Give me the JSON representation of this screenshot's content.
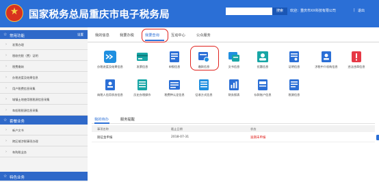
{
  "header": {
    "title": "国家税务总局重庆市电子税务局",
    "search_button": "搜索",
    "welcome": "欢迎：重庆市XX科技有限公司",
    "separator": "|",
    "logout": "退出"
  },
  "sidebar": {
    "section1": {
      "label": "常用功能",
      "setting": "设置"
    },
    "items1": [
      "发票办理",
      "税收完税（费）证明",
      "税费缴纳",
      "办税进度及结果信息",
      "用户税费信息采集",
      "城镇土地使用税税源信息采集",
      "车船税税源信息采集"
    ],
    "section2": {
      "label": "套餐业务"
    },
    "items2": [
      "新户文书",
      "跨区域涉税事项办理",
      "车购税业务"
    ],
    "section3": {
      "label": "特色业务"
    }
  },
  "tabs": [
    "我的信息",
    "我要办税",
    "我要查询",
    "互动中心",
    "公众服务"
  ],
  "active_tab": "我要查询",
  "icons": [
    {
      "label": "办税进度及结果信息",
      "icon": "progress-arrows-icon",
      "color": "#1f8fe0"
    },
    {
      "label": "发票信息",
      "icon": "invoice-icon",
      "color": "#18a6a6"
    },
    {
      "label": "申报信息",
      "icon": "declaration-icon",
      "color": "#2b6fd6"
    },
    {
      "label": "缴款信息",
      "icon": "payment-card-icon",
      "color": "#2b6fd6"
    },
    {
      "label": "文书信息",
      "icon": "document-icon",
      "color": "#1f8fe0"
    },
    {
      "label": "优惠信息",
      "icon": "discount-user-icon",
      "color": "#18a6a6"
    },
    {
      "label": "证明信息",
      "icon": "certificate-icon",
      "color": "#2b6fd6"
    },
    {
      "label": "涉税中介机构信息",
      "icon": "agency-icon",
      "color": "#2b6fd6"
    },
    {
      "label": "违法违章信息",
      "icon": "warning-icon",
      "color": "#e63946"
    },
    {
      "label": "纳税人信用状态信息",
      "icon": "credit-icon",
      "color": "#2b6fd6"
    },
    {
      "label": "历史办税操作",
      "icon": "history-icon",
      "color": "#18a6a6"
    },
    {
      "label": "税费种认定信息",
      "icon": "tax-type-icon",
      "color": "#2b6fd6"
    },
    {
      "label": "征收方式信息",
      "icon": "collection-icon",
      "color": "#1f8fe0"
    },
    {
      "label": "财务报表",
      "icon": "report-icon",
      "color": "#2b6fd6"
    },
    {
      "label": "存款账户信息",
      "icon": "account-icon",
      "color": "#2b6fd6"
    },
    {
      "label": "税源信息",
      "icon": "tax-source-icon",
      "color": "#2b6fd6"
    }
  ],
  "lower": {
    "tabs": [
      "我的待办",
      "服务提醒"
    ],
    "columns": [
      "事项名称",
      "截止日期",
      "状态",
      "操作"
    ],
    "rows": [
      {
        "name": "随征金申报",
        "date": "2018-07-31",
        "status": "逾期未申报",
        "action": "办理"
      }
    ]
  }
}
